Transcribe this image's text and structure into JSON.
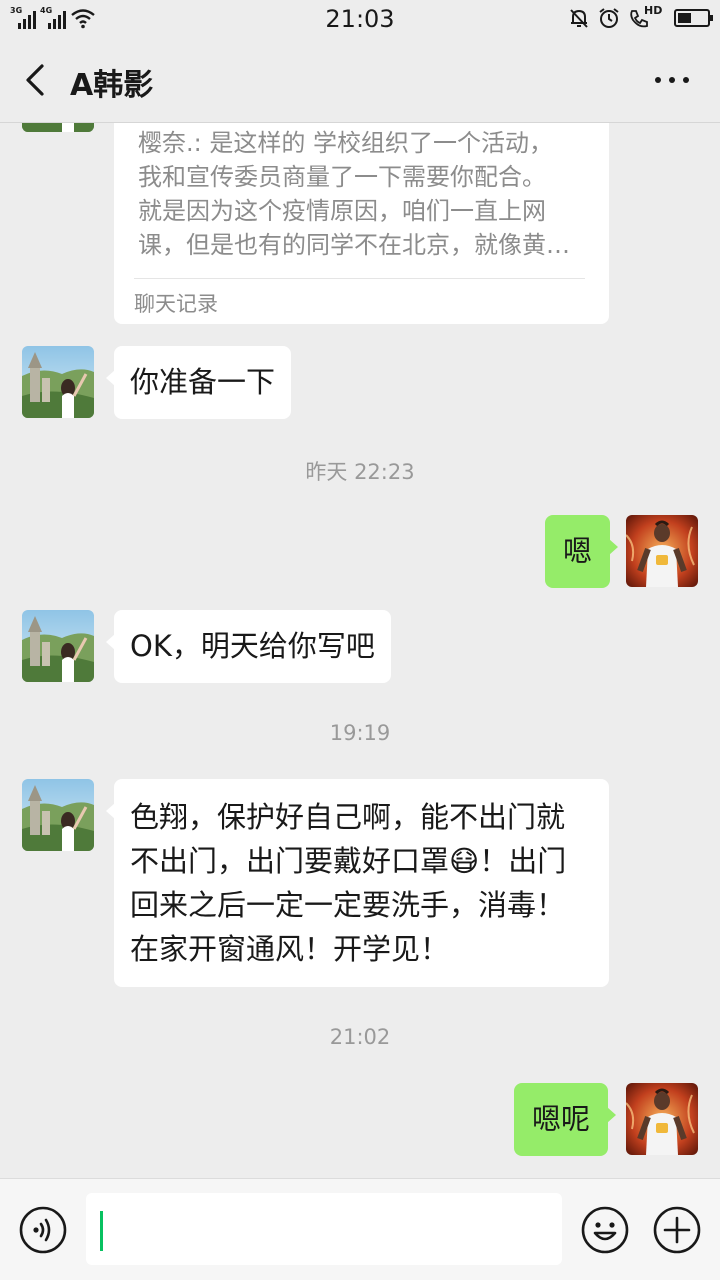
{
  "status_bar": {
    "time": "21:03",
    "network1": "3G",
    "network2": "4G",
    "hd_label": "HD"
  },
  "header": {
    "title": "A韩影"
  },
  "chat_record": {
    "lines": [
      "樱奈.: 是这样的 学校组织了一个活动，",
      "我和宣传委员商量了一下需要你配合。",
      "就是因为这个疫情原因，咱们一直上网",
      "课，但是也有的同学不在北京，就像黄…"
    ],
    "label": "聊天记录"
  },
  "messages": [
    {
      "type": "in",
      "text": "你准备一下"
    },
    {
      "type": "time",
      "text": "昨天 22:23"
    },
    {
      "type": "out",
      "text": "嗯"
    },
    {
      "type": "in",
      "text": "OK，明天给你写吧"
    },
    {
      "type": "time",
      "text": "19:19"
    },
    {
      "type": "in",
      "text": "色翔，保护好自己啊，能不出门就不出门，出门要戴好口罩😷！出门回来之后一定一定要洗手，消毒！在家开窗通风！开学见！"
    },
    {
      "type": "time",
      "text": "21:02"
    },
    {
      "type": "out",
      "text": "嗯呢"
    }
  ],
  "colors": {
    "background": "#ededed",
    "outgoing_bubble": "#95ec69",
    "incoming_bubble": "#ffffff",
    "caret": "#07c160"
  }
}
